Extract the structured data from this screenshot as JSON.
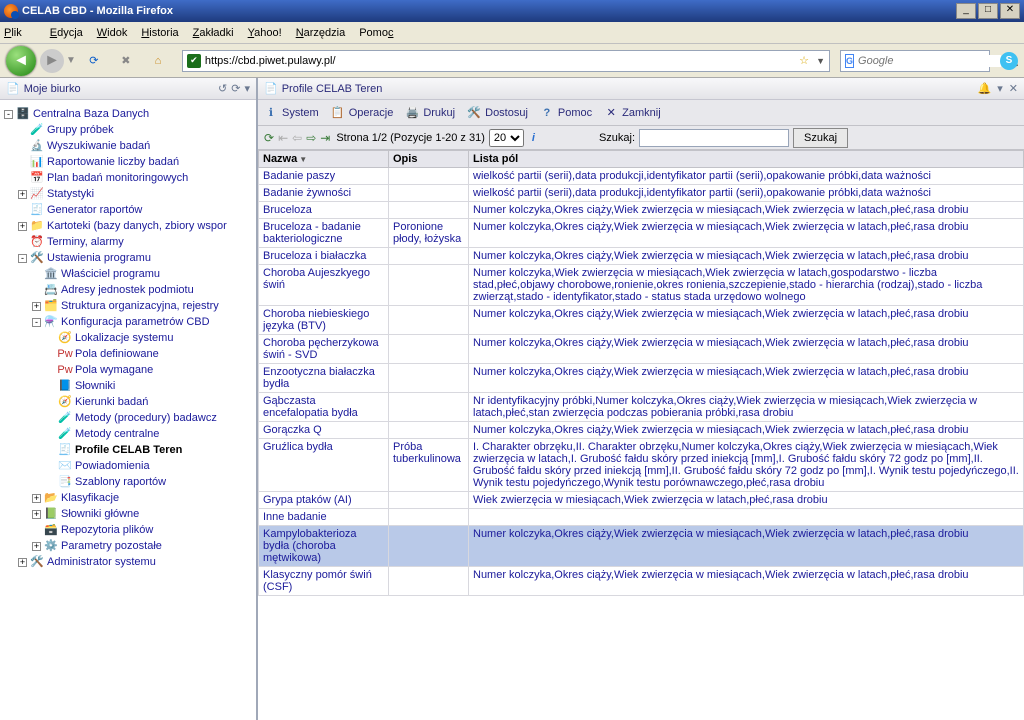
{
  "window": {
    "title": "CELAB CBD - Mozilla Firefox"
  },
  "menu": {
    "items": [
      "Plik",
      "Edycja",
      "Widok",
      "Historia",
      "Zakładki",
      "Yahoo!",
      "Narzędzia",
      "Pomoc"
    ]
  },
  "nav": {
    "url": "https://cbd.piwet.pulawy.pl/",
    "search_placeholder": "Google"
  },
  "left": {
    "title": "Moje biurko"
  },
  "tree": {
    "root": "Centralna Baza Danych",
    "n1": "Grupy próbek",
    "n2": "Wyszukiwanie badań",
    "n3": "Raportowanie liczby badań",
    "n4": "Plan badań monitoringowych",
    "n5": "Statystyki",
    "n6": "Generator raportów",
    "n7": "Kartoteki (bazy danych, zbiory wspor",
    "n8": "Terminy, alarmy",
    "n9": "Ustawienia programu",
    "n9a": "Właściciel programu",
    "n9b": "Adresy jednostek podmiotu",
    "n9c": "Struktura organizacyjna, rejestry",
    "n9d": "Konfiguracja parametrów CBD",
    "n9d1": "Lokalizacje systemu",
    "n9d2": "Pola definiowane",
    "n9d3": "Pola wymagane",
    "n9d4": "Słowniki",
    "n9d5": "Kierunki badań",
    "n9d6": "Metody (procedury) badawcz",
    "n9d7": "Metody centralne",
    "n9d8": "Profile CELAB Teren",
    "n9d9": "Powiadomienia",
    "n9d10": "Szablony raportów",
    "n9e": "Klasyfikacje",
    "n9f": "Słowniki główne",
    "n9g": "Repozytoria plików",
    "n9h": "Parametry pozostałe",
    "n10": "Administrator systemu"
  },
  "right": {
    "title": "Profile CELAB Teren"
  },
  "toolbar": {
    "system": "System",
    "operacje": "Operacje",
    "drukuj": "Drukuj",
    "dostosuj": "Dostosuj",
    "pomoc": "Pomoc",
    "zamknij": "Zamknij"
  },
  "pager": {
    "text": "Strona 1/2 (Pozycje 1-20 z 31)",
    "page_size": "20",
    "search_label": "Szukaj:",
    "search_btn": "Szukaj"
  },
  "columns": {
    "c1": "Nazwa",
    "c2": "Opis",
    "c3": "Lista pól"
  },
  "rows": [
    {
      "nazwa": "Badanie paszy",
      "opis": "",
      "lista": "wielkość partii (serii),data produkcji,identyfikator partii (serii),opakowanie próbki,data ważności"
    },
    {
      "nazwa": "Badanie żywności",
      "opis": "",
      "lista": "wielkość partii (serii),data produkcji,identyfikator partii (serii),opakowanie próbki,data ważności"
    },
    {
      "nazwa": "Bruceloza",
      "opis": "",
      "lista": "Numer kolczyka,Okres ciąży,Wiek zwierzęcia w miesiącach,Wiek zwierzęcia w latach,płeć,rasa drobiu"
    },
    {
      "nazwa": "Bruceloza - badanie bakteriologiczne",
      "opis": "Poronione płody, łożyska",
      "lista": "Numer kolczyka,Okres ciąży,Wiek zwierzęcia w miesiącach,Wiek zwierzęcia w latach,płeć,rasa drobiu"
    },
    {
      "nazwa": "Bruceloza i białaczka",
      "opis": "",
      "lista": "Numer kolczyka,Okres ciąży,Wiek zwierzęcia w miesiącach,Wiek zwierzęcia w latach,płeć,rasa drobiu"
    },
    {
      "nazwa": "Choroba Aujeszkyego świń",
      "opis": "",
      "lista": "Numer kolczyka,Wiek zwierzęcia w miesiącach,Wiek zwierzęcia w latach,gospodarstwo - liczba stad,płeć,objawy chorobowe,ronienie,okres ronienia,szczepienie,stado - hierarchia (rodzaj),stado - liczba zwierząt,stado - identyfikator,stado - status stada urzędowo wolnego"
    },
    {
      "nazwa": "Choroba niebieskiego języka (BTV)",
      "opis": "",
      "lista": "Numer kolczyka,Okres ciąży,Wiek zwierzęcia w miesiącach,Wiek zwierzęcia w latach,płeć,rasa drobiu"
    },
    {
      "nazwa": "Choroba pęcherzykowa świń - SVD",
      "opis": "",
      "lista": "Numer kolczyka,Okres ciąży,Wiek zwierzęcia w miesiącach,Wiek zwierzęcia w latach,płeć,rasa drobiu"
    },
    {
      "nazwa": "Enzootyczna białaczka bydła",
      "opis": "",
      "lista": "Numer kolczyka,Okres ciąży,Wiek zwierzęcia w miesiącach,Wiek zwierzęcia w latach,płeć,rasa drobiu"
    },
    {
      "nazwa": "Gąbczasta encefalopatia bydła",
      "opis": "",
      "lista": "Nr identyfikacyjny próbki,Numer kolczyka,Okres ciąży,Wiek zwierzęcia w miesiącach,Wiek zwierzęcia w latach,płeć,stan zwierzęcia podczas pobierania próbki,rasa drobiu"
    },
    {
      "nazwa": "Gorączka Q",
      "opis": "",
      "lista": "Numer kolczyka,Okres ciąży,Wiek zwierzęcia w miesiącach,Wiek zwierzęcia w latach,płeć,rasa drobiu"
    },
    {
      "nazwa": "Gruźlica bydła",
      "opis": "Próba tuberkulinowa",
      "lista": "I. Charakter obrzęku,II. Charakter obrzęku,Numer kolczyka,Okres ciąży,Wiek zwierzęcia w miesiącach,Wiek zwierzęcia w latach,I. Grubość fałdu skóry przed iniekcją [mm],I. Grubość fałdu skóry 72 godz po [mm],II. Grubość fałdu skóry przed iniekcją [mm],II. Grubość fałdu skóry 72 godz po [mm],I. Wynik testu pojedyńczego,II. Wynik testu pojedyńczego,Wynik testu porównawczego,płeć,rasa drobiu"
    },
    {
      "nazwa": "Grypa ptaków (AI)",
      "opis": "",
      "lista": "Wiek zwierzęcia w miesiącach,Wiek zwierzęcia w latach,płeć,rasa drobiu"
    },
    {
      "nazwa": "Inne badanie",
      "opis": "",
      "lista": ""
    },
    {
      "nazwa": "Kampylobakterioza bydła (choroba mętwikowa)",
      "opis": "",
      "lista": "Numer kolczyka,Okres ciąży,Wiek zwierzęcia w miesiącach,Wiek zwierzęcia w latach,płeć,rasa drobiu"
    },
    {
      "nazwa": "Klasyczny pomór świń (CSF)",
      "opis": "",
      "lista": "Numer kolczyka,Okres ciąży,Wiek zwierzęcia w miesiącach,Wiek zwierzęcia w latach,płeć,rasa drobiu"
    }
  ],
  "selected_row_index": 14
}
